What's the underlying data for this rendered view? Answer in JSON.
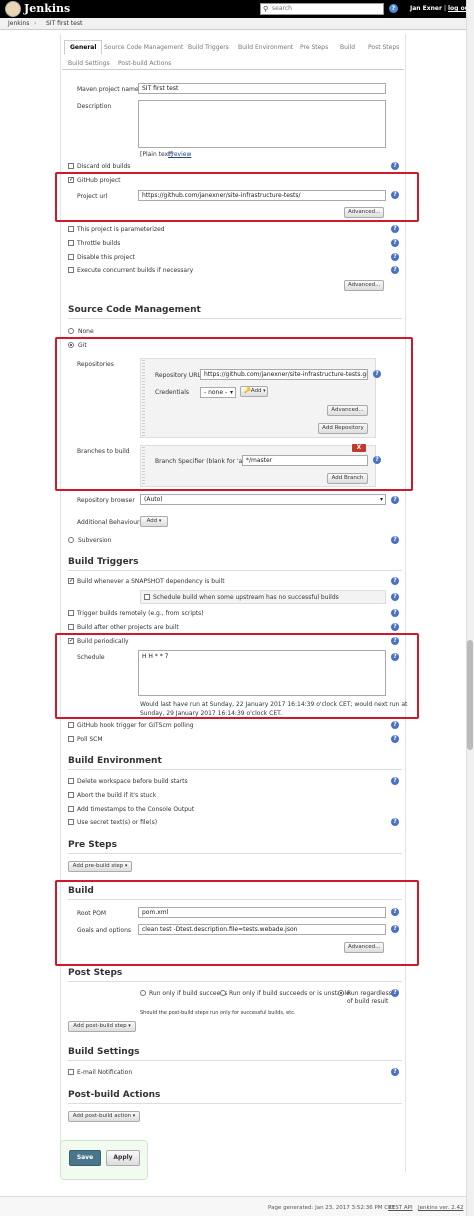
{
  "header": {
    "title": "Jenkins",
    "search_placeholder": "search",
    "help": "?",
    "user": "Jan Exner",
    "separator": "|",
    "logout": "log out"
  },
  "breadcrumb": {
    "items": [
      "Jenkins",
      "SIT first test"
    ],
    "sep": "›"
  },
  "tabs": {
    "row1": [
      "General",
      "Source Code Management",
      "Build Triggers",
      "Build Environment",
      "Pre Steps",
      "Build",
      "Post Steps"
    ],
    "row2": [
      "Build Settings",
      "Post-build Actions"
    ]
  },
  "general": {
    "project_name_label": "Maven project name",
    "project_name_value": "SIT first test",
    "description_label": "Description",
    "plain_text": "[Plain text]",
    "preview": "Preview",
    "discard_old_builds": "Discard old builds",
    "github_project": "GitHub project",
    "project_url_label": "Project url",
    "project_url_value": "https://github.com/janexner/site-infrastructure-tests/",
    "advanced": "Advanced...",
    "parameterized": "This project is parameterized",
    "throttle": "Throttle builds",
    "disable": "Disable this project",
    "concurrent": "Execute concurrent builds if necessary",
    "advanced2": "Advanced..."
  },
  "scm": {
    "heading": "Source Code Management",
    "none": "None",
    "git": "Git",
    "repositories_label": "Repositories",
    "repo_url_label": "Repository URL",
    "repo_url_value": "https://github.com/janexner/site-infrastructure-tests.git",
    "credentials_label": "Credentials",
    "credentials_value": "- none -",
    "add_cred": "Add",
    "advanced": "Advanced...",
    "add_repository": "Add Repository",
    "branches_label": "Branches to build",
    "delete": "X",
    "branch_spec_label": "Branch Specifier (blank for 'any')",
    "branch_spec_value": "*/master",
    "add_branch": "Add Branch",
    "repo_browser_label": "Repository browser",
    "repo_browser_value": "(Auto)",
    "additional_behaviours_label": "Additional Behaviours",
    "add": "Add",
    "subversion": "Subversion"
  },
  "triggers": {
    "heading": "Build Triggers",
    "snapshot": "Build whenever a SNAPSHOT dependency is built",
    "schedule_upstream": "Schedule build when some upstream has no successful builds",
    "remotely": "Trigger builds remotely (e.g., from scripts)",
    "after_other": "Build after other projects are built",
    "periodically": "Build periodically",
    "schedule_label": "Schedule",
    "schedule_value": "H H * * 7",
    "schedule_note1": "Would last have run at Sunday, 22 January 2017 16:14:39 o'clock CET; would next run at",
    "schedule_note2": "Sunday, 29 January 2017 16:14:39 o'clock CET.",
    "github_hook": "GitHub hook trigger for GITScm polling",
    "poll_scm": "Poll SCM"
  },
  "environment": {
    "heading": "Build Environment",
    "delete_workspace": "Delete workspace before build starts",
    "abort_stuck": "Abort the build if it's stuck",
    "timestamps": "Add timestamps to the Console Output",
    "secret_text": "Use secret text(s) or file(s)"
  },
  "pre_steps": {
    "heading": "Pre Steps",
    "add_pre_build": "Add pre-build step"
  },
  "build": {
    "heading": "Build",
    "root_pom_label": "Root POM",
    "root_pom_value": "pom.xml",
    "goals_label": "Goals and options",
    "goals_value": "clean test -Dtest.description.file=tests.webade.json",
    "advanced": "Advanced..."
  },
  "post_steps": {
    "heading": "Post Steps",
    "opt1": "Run only if build succeeds",
    "opt2": "Run only if build succeeds or is unstable",
    "opt3": "Run regardless",
    "opt3b": "of build result",
    "note": "Should the post-build steps run only for successful builds, etc.",
    "add_post_build": "Add post-build step"
  },
  "build_settings": {
    "heading": "Build Settings",
    "email": "E-mail Notification"
  },
  "post_build": {
    "heading": "Post-build Actions",
    "add_action": "Add post-build action"
  },
  "actions": {
    "save": "Save",
    "apply": "Apply"
  },
  "footer": {
    "generated": "Page generated: Jan 23, 2017 3:52:36 PM CET",
    "rest_api": "REST API",
    "version": "Jenkins ver. 2.42"
  },
  "colors": {
    "highlight": "#d0192b",
    "help": "#4a72c4",
    "save": "#4b758b"
  }
}
